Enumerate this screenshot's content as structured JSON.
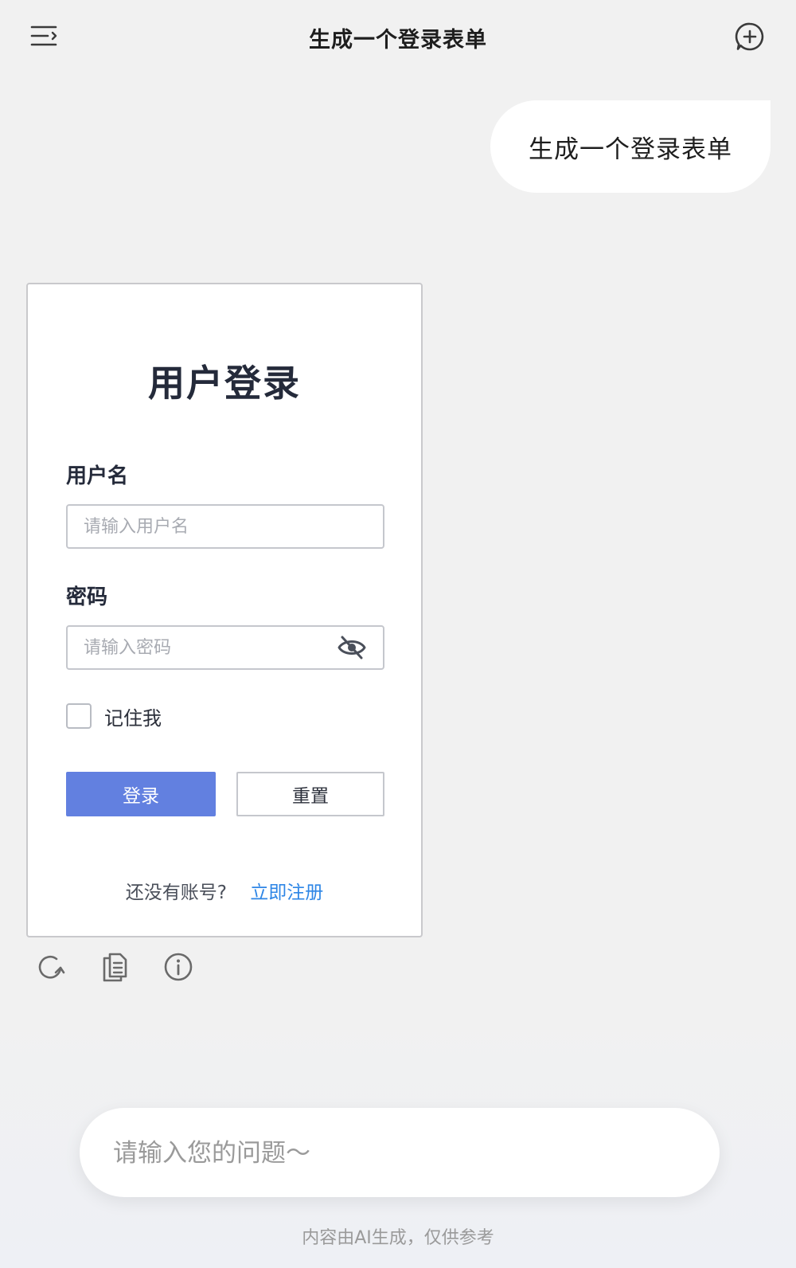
{
  "header": {
    "title": "生成一个登录表单",
    "menu_icon": "menu-icon",
    "new_chat_icon": "new-chat-icon"
  },
  "conversation": {
    "user_message": "生成一个登录表单"
  },
  "login_form": {
    "title": "用户登录",
    "username_label": "用户名",
    "username_placeholder": "请输入用户名",
    "username_value": "",
    "password_label": "密码",
    "password_placeholder": "请输入密码",
    "password_value": "",
    "password_toggle_icon": "eye-off-icon",
    "remember_label": "记住我",
    "remember_checked": false,
    "login_button": "登录",
    "reset_button": "重置",
    "register_prompt": "还没有账号?",
    "register_link": "立即注册",
    "colors": {
      "primary": "#6280e0",
      "link": "#2e86e6"
    }
  },
  "message_actions": {
    "regenerate_icon": "refresh-icon",
    "copy_icon": "copy-icon",
    "info_icon": "info-icon"
  },
  "composer": {
    "placeholder": "请输入您的问题～",
    "value": ""
  },
  "footer": {
    "disclaimer": "内容由AI生成，仅供参考"
  }
}
